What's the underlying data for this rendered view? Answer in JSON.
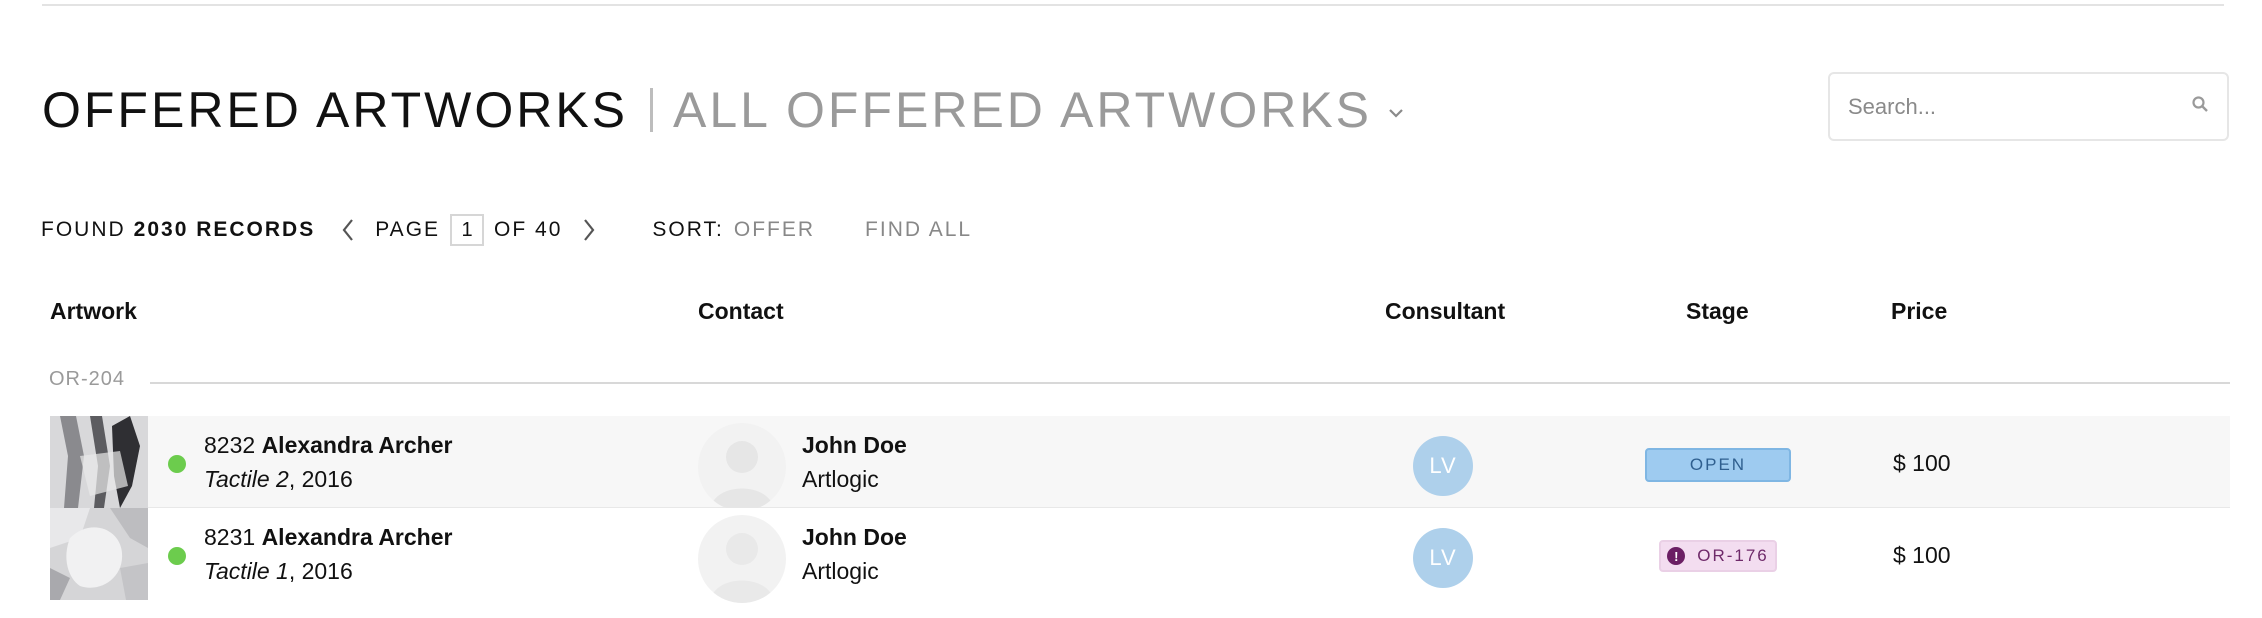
{
  "header": {
    "title": "OFFERED ARTWORKS",
    "view_name": "ALL OFFERED ARTWORKS",
    "view_icon": "chevron-down-icon"
  },
  "search": {
    "placeholder": "Search...",
    "icon": "search-icon"
  },
  "toolbar": {
    "found_label": "FOUND",
    "records_label": "2030 RECORDS",
    "page_label": "PAGE",
    "page_value": "1",
    "of_label": "OF 40",
    "sort_label": "SORT:",
    "sort_value": "OFFER",
    "find_all_label": "FIND ALL"
  },
  "columns": {
    "artwork": "Artwork",
    "contact": "Contact",
    "consultant": "Consultant",
    "stage": "Stage",
    "price": "Price"
  },
  "groups": [
    {
      "label": "OR-204",
      "rows": [
        {
          "artwork_number": "8232",
          "artist": "Alexandra Archer",
          "artwork_title": "Tactile 2",
          "year_suffix": ", 2016",
          "status_color": "#6ccc4d",
          "contact_name": "John Doe",
          "contact_org": "Artlogic",
          "consultant_initials": "LV",
          "stage": "OPEN",
          "price": "$ 100"
        },
        {
          "artwork_number": "8231",
          "artist": "Alexandra Archer",
          "artwork_title": "Tactile 1",
          "year_suffix": ", 2016",
          "status_color": "#6ccc4d",
          "contact_name": "John Doe",
          "contact_org": "Artlogic",
          "consultant_initials": "LV",
          "stage": "OR-176",
          "stage_icon": "alert-icon",
          "price": "$ 100"
        }
      ]
    }
  ],
  "colors": {
    "open_badge": "#9ecbf0",
    "ref_badge": "#f3ddf0",
    "consultant_avatar": "#aed0eb",
    "status_active": "#6ccc4d"
  }
}
